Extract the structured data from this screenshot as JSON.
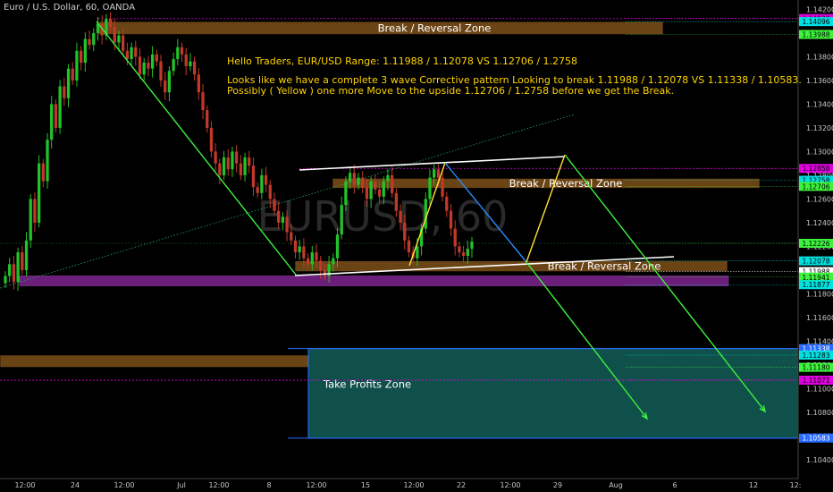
{
  "header": {
    "symbol": "Euro / U.S. Dollar, 60, OANDA"
  },
  "watermark": "EURUSD, 60",
  "colors": {
    "background": "#000000",
    "up_candle": "#22c32a",
    "down_candle": "#c0392b",
    "zone_brown": "#6a4414",
    "zone_purple": "#6b1f7a",
    "profit_zone": "#10504a",
    "yellow": "#ffe13a",
    "green_arrow": "#3ef23e",
    "blue_line": "#2a8cff",
    "white_line": "#ffffff",
    "dotted_green": "#2aa36a"
  },
  "chart_data": {
    "type": "candlestick",
    "title": "Euro / U.S. Dollar, 60, OANDA",
    "ylim": [
      1.1035,
      1.1425
    ],
    "x_ticks": [
      "12:00",
      "24",
      "12:00",
      "Jul",
      "12:00",
      "8",
      "12:00",
      "15",
      "12:00",
      "22",
      "12:00",
      "29",
      "Aug",
      "6",
      "12",
      "12:"
    ],
    "y_ticks": [
      "1.14200",
      "1.14000",
      "1.13800",
      "1.13600",
      "1.13400",
      "1.13200",
      "1.13000",
      "1.12800",
      "1.12600",
      "1.12400",
      "1.12200",
      "1.12000",
      "1.11800",
      "1.11600",
      "1.11400",
      "1.11200",
      "1.11000",
      "1.10800",
      "1.10600",
      "1.10400"
    ],
    "y_tick_values": [
      1.142,
      1.14,
      1.138,
      1.136,
      1.134,
      1.132,
      1.13,
      1.128,
      1.126,
      1.124,
      1.122,
      1.12,
      1.118,
      1.116,
      1.114,
      1.112,
      1.11,
      1.108,
      1.106,
      1.104
    ],
    "price_badges": [
      {
        "label": "1.14122",
        "value": 1.14122,
        "bg": "#e000e0",
        "fg": "#000000"
      },
      {
        "label": "1.14096",
        "value": 1.14096,
        "bg": "#00e0e0",
        "fg": "#000000"
      },
      {
        "label": "1.13988",
        "value": 1.13988,
        "bg": "#3ef23e",
        "fg": "#000000"
      },
      {
        "label": "1.12858",
        "value": 1.12858,
        "bg": "#e000e0",
        "fg": "#000000"
      },
      {
        "label": "1.12758",
        "value": 1.12758,
        "bg": "#00e0e0",
        "fg": "#000000"
      },
      {
        "label": "1.12706",
        "value": 1.12706,
        "bg": "#3ef23e",
        "fg": "#000000"
      },
      {
        "label": "1.12226",
        "value": 1.12226,
        "bg": "#3ef23e",
        "fg": "#000000"
      },
      {
        "label": "1.12078",
        "value": 1.12078,
        "bg": "#00e0e0",
        "fg": "#000000"
      },
      {
        "label": "1.11988",
        "value": 1.11988,
        "bg": "#ffffff",
        "fg": "#000000"
      },
      {
        "label": "1.11941",
        "value": 1.11941,
        "bg": "#3ef23e",
        "fg": "#000000"
      },
      {
        "label": "1.11877",
        "value": 1.11877,
        "bg": "#00e0e0",
        "fg": "#000000"
      },
      {
        "label": "1.11338",
        "value": 1.11338,
        "bg": "#2a6cff",
        "fg": "#ffffff"
      },
      {
        "label": "1.11283",
        "value": 1.11283,
        "bg": "#00e0e0",
        "fg": "#000000"
      },
      {
        "label": "1.11180",
        "value": 1.1118,
        "bg": "#3ef23e",
        "fg": "#000000"
      },
      {
        "label": "1.11071",
        "value": 1.11071,
        "bg": "#e000e0",
        "fg": "#000000"
      },
      {
        "label": "1.10583",
        "value": 1.10583,
        "bg": "#2a6cff",
        "fg": "#ffffff"
      }
    ],
    "zones": [
      {
        "label": "Break / Reversal Zone",
        "top": 1.14096,
        "bottom": 1.13988,
        "color": "brown"
      },
      {
        "label": "Break / Reversal Zone",
        "top": 1.12758,
        "bottom": 1.12706,
        "color": "brown"
      },
      {
        "label": "Break / Reversal Zone",
        "top": 1.12078,
        "bottom": 1.11988,
        "color": "brown"
      },
      {
        "label": "",
        "top": 1.11941,
        "bottom": 1.11877,
        "color": "purple"
      },
      {
        "label": "Break / Reversal Zone",
        "top": 1.11283,
        "bottom": 1.1118,
        "color": "brown"
      },
      {
        "label": "Take Profits Zone",
        "top": 1.11338,
        "bottom": 1.10583,
        "color": "teal"
      }
    ],
    "annotations": [
      "Hello  Traders, EUR/USD Range: 1.11988 / 1.12078 VS 1.12706 / 1.2758",
      "Looks like we have a complete 3 wave Corrective pattern Looking to break 1.11988 / 1.12078 VS 1.11338 / 1.10583.",
      "Possibly ( Yellow ) one more Move to the upside 1.12706 / 1.2758 before we get the Break."
    ],
    "series": [
      {
        "values": [
          1.1195,
          1.1205,
          1.119,
          1.1215,
          1.12,
          1.1225,
          1.126,
          1.124,
          1.129,
          1.1275,
          1.131,
          1.134,
          1.132,
          1.1355,
          1.1345,
          1.137,
          1.136,
          1.1385,
          1.1375,
          1.1395,
          1.139,
          1.14,
          1.1408,
          1.1398,
          1.1412,
          1.1405,
          1.1392,
          1.1398,
          1.1385,
          1.1378,
          1.1388,
          1.138,
          1.1365,
          1.1375,
          1.137,
          1.1382,
          1.1376,
          1.136,
          1.135,
          1.1368,
          1.1378,
          1.1388,
          1.1382,
          1.1372,
          1.1376,
          1.1365,
          1.135,
          1.1335,
          1.132,
          1.13,
          1.129,
          1.128,
          1.1295,
          1.1285,
          1.13,
          1.129,
          1.128,
          1.1295,
          1.1288,
          1.127,
          1.1265,
          1.128,
          1.1272,
          1.126,
          1.125,
          1.124,
          1.1245,
          1.1232,
          1.1225,
          1.1215,
          1.122,
          1.121,
          1.1205,
          1.1215,
          1.1208,
          1.12,
          1.1195,
          1.1205,
          1.121,
          1.123,
          1.1255,
          1.1275,
          1.1282,
          1.1272,
          1.1278,
          1.127,
          1.126,
          1.1275,
          1.1268,
          1.1262,
          1.1275,
          1.128,
          1.1265,
          1.125,
          1.124,
          1.1225,
          1.1215,
          1.121,
          1.122,
          1.1235,
          1.126,
          1.1278,
          1.1285,
          1.1278,
          1.1262,
          1.125,
          1.1235,
          1.122,
          1.1215,
          1.1212,
          1.1218,
          1.1224
        ]
      }
    ]
  }
}
